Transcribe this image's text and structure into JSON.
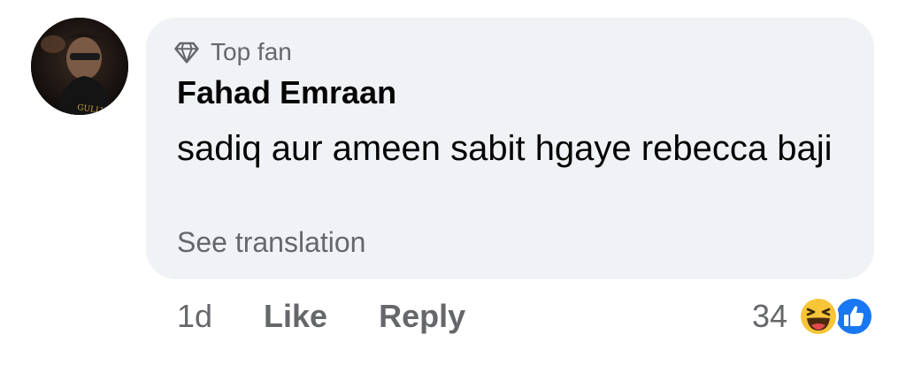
{
  "comment": {
    "badge_label": "Top fan",
    "author": "Fahad  Emraan",
    "text": "sadiq aur ameen sabit hgaye rebecca baji",
    "see_translation": "See translation",
    "avatar_caption": "GULLYGANG"
  },
  "actions": {
    "time": "1d",
    "like": "Like",
    "reply": "Reply"
  },
  "reactions": {
    "count": "34",
    "icons": [
      "haha-icon",
      "like-icon"
    ]
  },
  "colors": {
    "bubble": "#f0f2f5",
    "secondary_text": "#65676b",
    "primary_text": "#050505",
    "like_blue": "#1877f2",
    "haha_yellow": "#f7c537"
  }
}
